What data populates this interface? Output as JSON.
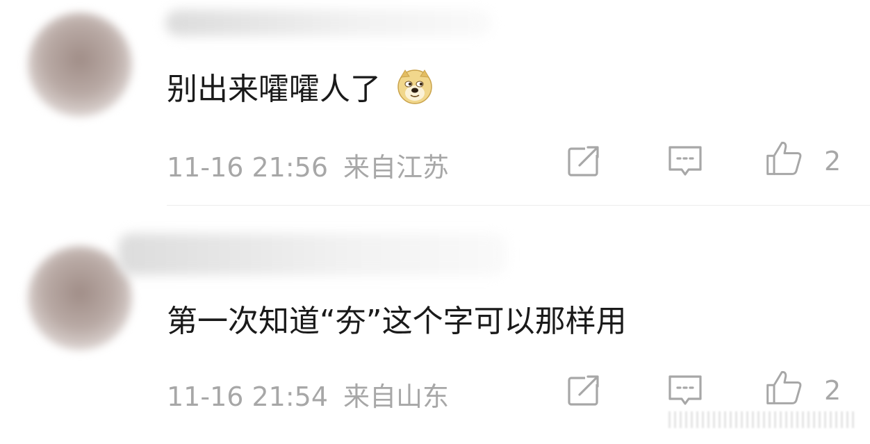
{
  "comments": [
    {
      "text": "别出来嚯嚯人了",
      "emoji": "doge-emoji",
      "time": "11-16 21:56",
      "location": "来自江苏",
      "likes": "2"
    },
    {
      "text": "第一次知道“夯”这个字可以那样用",
      "time": "11-16 21:54",
      "location": "来自山东",
      "likes": "2"
    }
  ],
  "icons": {
    "share": "share-icon",
    "comment": "comment-icon",
    "like": "thumbs-up-icon"
  },
  "colors": {
    "text": "#1a1a1a",
    "meta": "#a7a7a7",
    "divider": "#ededed"
  }
}
